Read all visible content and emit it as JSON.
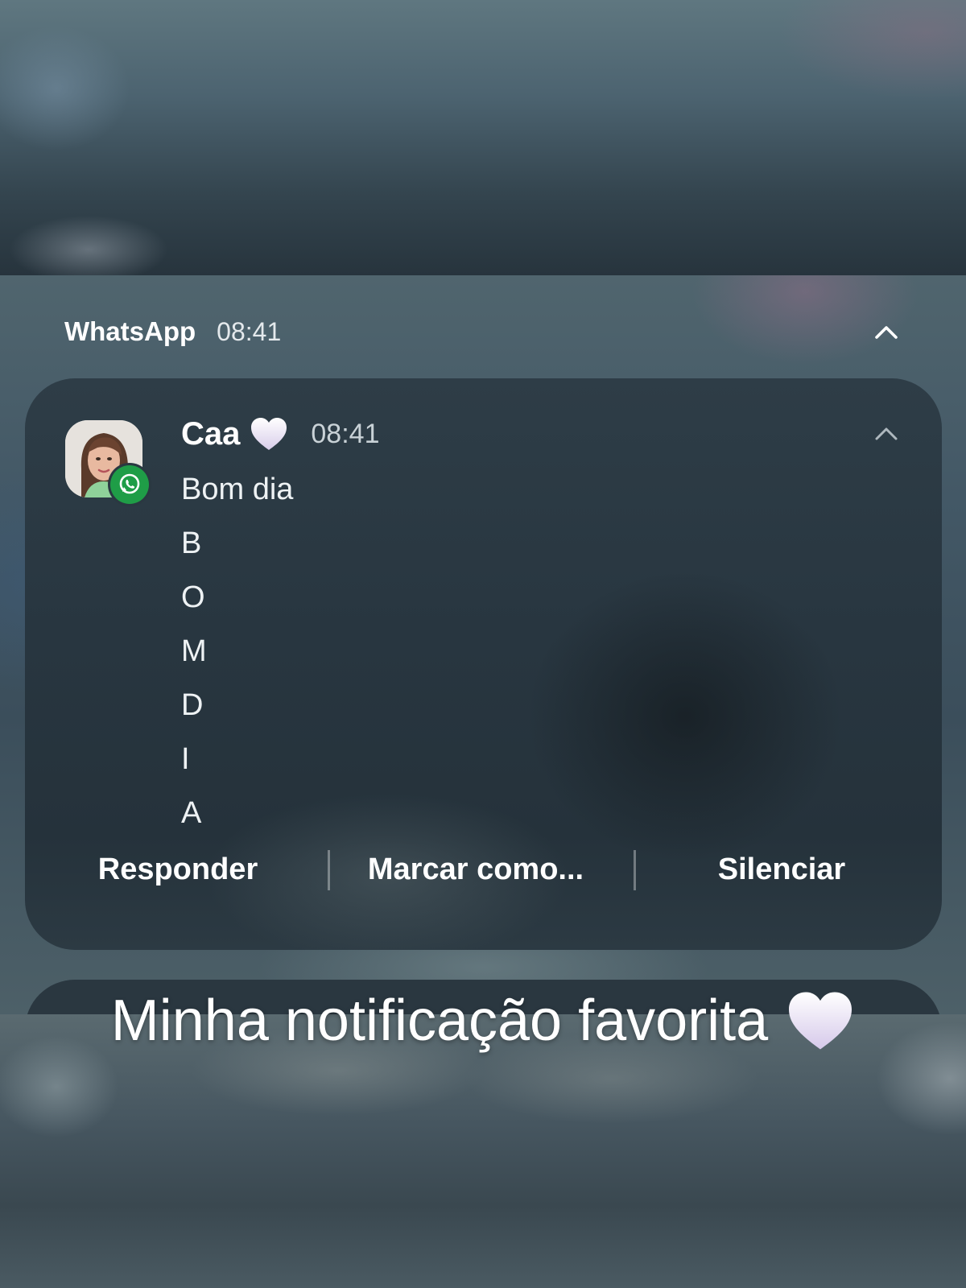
{
  "notification_group": {
    "app_name": "WhatsApp",
    "time": "08:41"
  },
  "notification": {
    "sender": "Caa",
    "time": "08:41",
    "message_lines": [
      "Bom dia",
      "B",
      "O",
      "M",
      "D",
      "I",
      "A"
    ],
    "actions": {
      "reply": "Responder",
      "mark_as": "Marcar como...",
      "mute": "Silenciar"
    }
  },
  "caption": {
    "text": "Minha notificação favorita"
  },
  "icons": {
    "collapse": "chevron-up-icon",
    "app_badge": "whatsapp-icon",
    "emoji": "white-heart-emoji"
  },
  "colors": {
    "whatsapp_green": "#1f9d47",
    "card_background": "#283640",
    "text_primary": "#ffffff"
  }
}
